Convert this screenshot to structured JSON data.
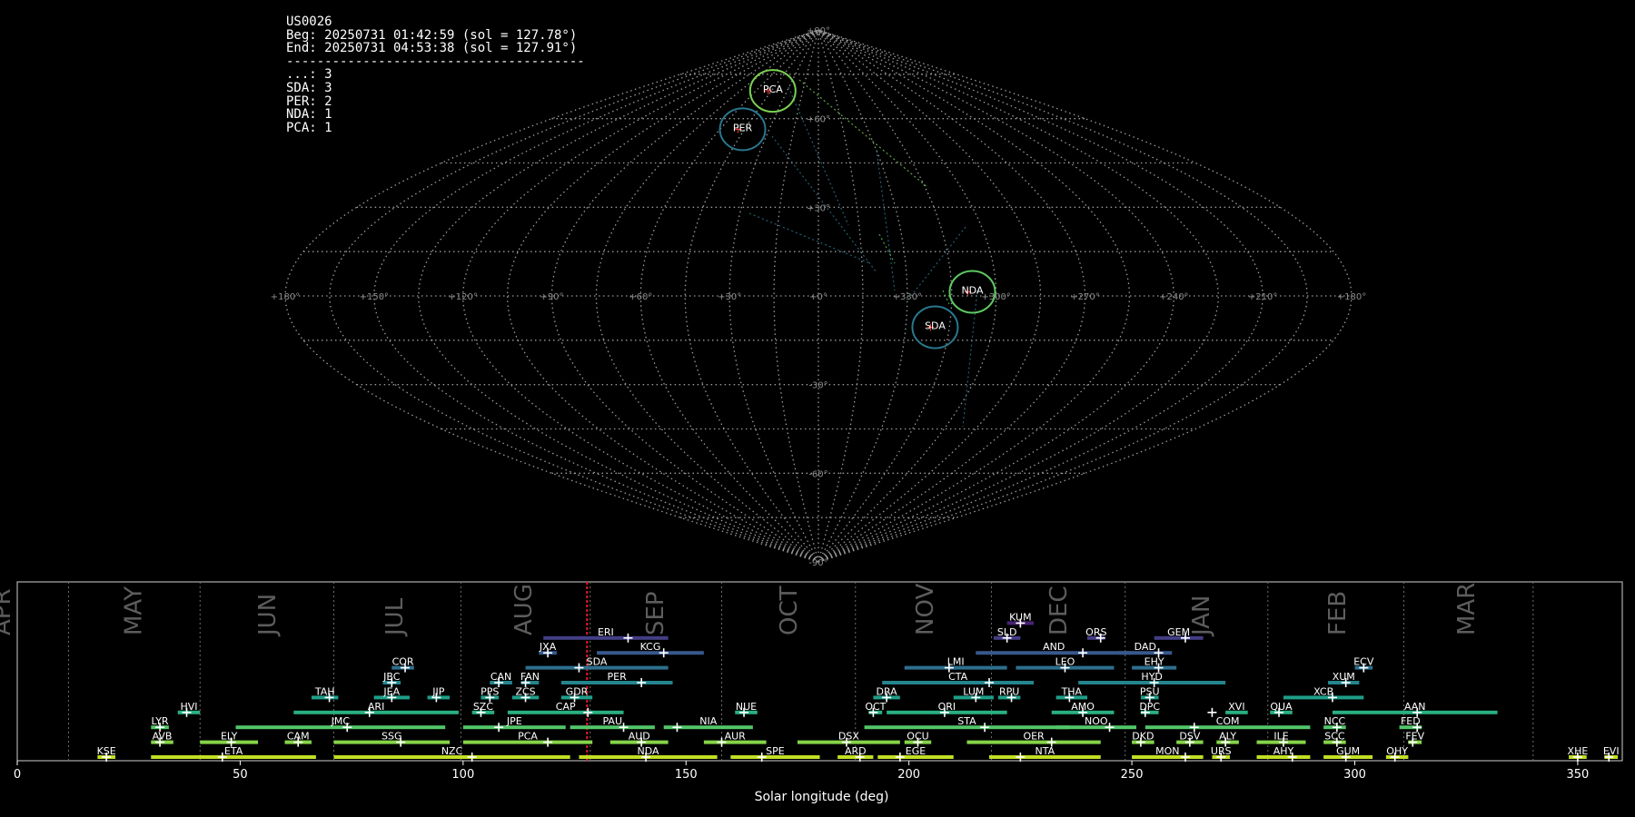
{
  "info": {
    "station": "US0026",
    "begin": "Beg: 20250731 01:42:59 (sol = 127.78°)",
    "end": "End: 20250731 04:53:38 (sol = 127.91°)",
    "separator": "---------------------------------------",
    "counts": [
      "...: 3",
      "SDA: 3",
      "PER: 2",
      "NDA: 1",
      "PCA: 1"
    ]
  },
  "chart_data": [
    {
      "type": "scatter",
      "projection": "sinusoidal",
      "grid": true,
      "lon_tick_labels": [
        "+180°",
        "+150°",
        "+120°",
        "+90°",
        "+60°",
        "+30°",
        "+0°",
        "+330°",
        "+300°",
        "+270°",
        "+240°",
        "+210°",
        "+180°"
      ],
      "lat_tick_labels": [
        "+90°",
        "+60°",
        "+30°",
        "-30°",
        "-60°",
        "-90°"
      ],
      "lon_ticks": [
        180,
        150,
        120,
        90,
        60,
        30,
        0,
        -30,
        -60,
        -90,
        -120,
        -150,
        -180
      ],
      "lat_ticks": [
        90,
        60,
        30,
        -30,
        -60,
        -90
      ],
      "radiants": [
        {
          "name": "PCA",
          "lon": 45,
          "lat": 70,
          "color": "#7ad151"
        },
        {
          "name": "PER",
          "lon": 47,
          "lat": 57,
          "color": "#2a788e"
        },
        {
          "name": "NDA",
          "lon": -52,
          "lat": 2,
          "color": "#5ec962"
        },
        {
          "name": "SDA",
          "lon": -40,
          "lat": -10,
          "color": "#2a788e"
        }
      ]
    },
    {
      "type": "timeline",
      "xlabel": "Solar longitude (deg)",
      "xlim": [
        0,
        360
      ],
      "xticks": [
        0,
        50,
        100,
        150,
        200,
        250,
        300,
        350
      ],
      "current_sol": 127.8,
      "months": [
        {
          "name": "APR",
          "sol": 11.5
        },
        {
          "name": "MAY",
          "sol": 41
        },
        {
          "name": "JUN",
          "sol": 71
        },
        {
          "name": "JUL",
          "sol": 99.5
        },
        {
          "name": "AUG",
          "sol": 128.5
        },
        {
          "name": "SEP",
          "sol": 158
        },
        {
          "name": "OCT",
          "sol": 188
        },
        {
          "name": "NOV",
          "sol": 218.5
        },
        {
          "name": "DEC",
          "sol": 248.5
        },
        {
          "name": "JAN",
          "sol": 280.5
        },
        {
          "name": "FEB",
          "sol": 311
        },
        {
          "name": "MAR",
          "sol": 340
        }
      ],
      "showers": [
        {
          "code": "KUM",
          "start": 222,
          "end": 228,
          "peak": 225,
          "row": 10
        },
        {
          "code": "ERI",
          "start": 118,
          "end": 146,
          "peak": 137,
          "row": 9
        },
        {
          "code": "SLD",
          "start": 219,
          "end": 225,
          "peak": 222,
          "row": 9
        },
        {
          "code": "ORS",
          "start": 240,
          "end": 244,
          "peak": 243,
          "row": 9
        },
        {
          "code": "GEM",
          "start": 255,
          "end": 266,
          "peak": 262,
          "row": 9
        },
        {
          "code": "JXA",
          "start": 117,
          "end": 121,
          "peak": 119,
          "row": 8
        },
        {
          "code": "KCG",
          "start": 130,
          "end": 154,
          "peak": 145,
          "row": 8
        },
        {
          "code": "AND",
          "start": 215,
          "end": 250,
          "peak": 239,
          "row": 8
        },
        {
          "code": "DAD",
          "start": 247,
          "end": 259,
          "peak": 256,
          "row": 8
        },
        {
          "code": "COR",
          "start": 84,
          "end": 89,
          "peak": 87,
          "row": 7
        },
        {
          "code": "SDA",
          "start": 114,
          "end": 146,
          "peak": 126,
          "row": 7
        },
        {
          "code": "LMI",
          "start": 199,
          "end": 222,
          "peak": 209,
          "row": 7
        },
        {
          "code": "LEO",
          "start": 224,
          "end": 246,
          "peak": 235,
          "row": 7
        },
        {
          "code": "EHY",
          "start": 250,
          "end": 260,
          "peak": 256,
          "row": 7
        },
        {
          "code": "ECV",
          "start": 300,
          "end": 304,
          "peak": 302,
          "row": 7
        },
        {
          "code": "JBC",
          "start": 82,
          "end": 86,
          "peak": 84,
          "row": 6
        },
        {
          "code": "CAN",
          "start": 106,
          "end": 111,
          "peak": 108,
          "row": 6
        },
        {
          "code": "FAN",
          "start": 113,
          "end": 117,
          "peak": 114,
          "row": 6
        },
        {
          "code": "PER",
          "start": 122,
          "end": 147,
          "peak": 140,
          "row": 6
        },
        {
          "code": "CTA",
          "start": 194,
          "end": 228,
          "peak": 218,
          "row": 6
        },
        {
          "code": "HYD",
          "start": 238,
          "end": 271,
          "peak": 255,
          "row": 6
        },
        {
          "code": "XUM",
          "start": 294,
          "end": 301,
          "peak": 298,
          "row": 6
        },
        {
          "code": "TAH",
          "start": 66,
          "end": 72,
          "peak": 70,
          "row": 5
        },
        {
          "code": "JEA",
          "start": 80,
          "end": 88,
          "peak": 84,
          "row": 5
        },
        {
          "code": "JIP",
          "start": 92,
          "end": 97,
          "peak": 94,
          "row": 5
        },
        {
          "code": "PPS",
          "start": 104,
          "end": 108,
          "peak": 106,
          "row": 5
        },
        {
          "code": "ZCS",
          "start": 111,
          "end": 117,
          "peak": 114,
          "row": 5
        },
        {
          "code": "GDR",
          "start": 122,
          "end": 129,
          "peak": 125,
          "row": 5
        },
        {
          "code": "DRA",
          "start": 192,
          "end": 198,
          "peak": 195,
          "row": 5
        },
        {
          "code": "LUM",
          "start": 210,
          "end": 219,
          "peak": 215,
          "row": 5
        },
        {
          "code": "RPU",
          "start": 220,
          "end": 225,
          "peak": 223,
          "row": 5
        },
        {
          "code": "THA",
          "start": 233,
          "end": 240,
          "peak": 236,
          "row": 5
        },
        {
          "code": "PSU",
          "start": 252,
          "end": 256,
          "peak": 254,
          "row": 5
        },
        {
          "code": "XCB",
          "start": 284,
          "end": 302,
          "peak": 295,
          "row": 5
        },
        {
          "code": "HVI",
          "start": 36,
          "end": 41,
          "peak": 38,
          "row": 4
        },
        {
          "code": "ARI",
          "start": 62,
          "end": 99,
          "peak": 79,
          "row": 4
        },
        {
          "code": "SZC",
          "start": 102,
          "end": 107,
          "peak": 104,
          "row": 4
        },
        {
          "code": "CAP",
          "start": 110,
          "end": 136,
          "peak": 128,
          "row": 4
        },
        {
          "code": "NUE",
          "start": 161,
          "end": 166,
          "peak": 163,
          "row": 4
        },
        {
          "code": "OCT",
          "start": 191,
          "end": 194,
          "peak": 192,
          "row": 4
        },
        {
          "code": "ORI",
          "start": 195,
          "end": 222,
          "peak": 208,
          "row": 4
        },
        {
          "code": "AMO",
          "start": 232,
          "end": 246,
          "peak": 239,
          "row": 4
        },
        {
          "code": "DPC",
          "start": 252,
          "end": 256,
          "peak": 253,
          "row": 4
        },
        {
          "code": "XVI",
          "start": 271,
          "end": 276,
          "peak": 268,
          "row": 4
        },
        {
          "code": "QUA",
          "start": 281,
          "end": 286,
          "peak": 283,
          "row": 4
        },
        {
          "code": "AAN",
          "start": 295,
          "end": 332,
          "peak": 314,
          "row": 4
        },
        {
          "code": "LYR",
          "start": 30,
          "end": 34,
          "peak": 32,
          "row": 3
        },
        {
          "code": "JMC",
          "start": 49,
          "end": 96,
          "peak": 74,
          "row": 3
        },
        {
          "code": "JPE",
          "start": 100,
          "end": 123,
          "peak": 108,
          "row": 3
        },
        {
          "code": "PAU",
          "start": 124,
          "end": 143,
          "peak": 136,
          "row": 3
        },
        {
          "code": "NIA",
          "start": 145,
          "end": 165,
          "peak": 148,
          "row": 3
        },
        {
          "code": "STA",
          "start": 190,
          "end": 236,
          "peak": 217,
          "row": 3
        },
        {
          "code": "NOO",
          "start": 233,
          "end": 251,
          "peak": 245,
          "row": 3
        },
        {
          "code": "COM",
          "start": 253,
          "end": 290,
          "peak": 264,
          "row": 3
        },
        {
          "code": "NCC",
          "start": 293,
          "end": 298,
          "peak": 296,
          "row": 3
        },
        {
          "code": "FED",
          "start": 310,
          "end": 315,
          "peak": 314,
          "row": 3
        },
        {
          "code": "AVB",
          "start": 30,
          "end": 35,
          "peak": 32,
          "row": 2
        },
        {
          "code": "ELY",
          "start": 41,
          "end": 54,
          "peak": 48,
          "row": 2
        },
        {
          "code": "CAM",
          "start": 60,
          "end": 66,
          "peak": 63,
          "row": 2
        },
        {
          "code": "SSG",
          "start": 71,
          "end": 97,
          "peak": 86,
          "row": 2
        },
        {
          "code": "PCA",
          "start": 100,
          "end": 129,
          "peak": 119,
          "row": 2
        },
        {
          "code": "AUD",
          "start": 133,
          "end": 146,
          "peak": 140,
          "row": 2
        },
        {
          "code": "AUR",
          "start": 154,
          "end": 168,
          "peak": 158,
          "row": 2
        },
        {
          "code": "DSX",
          "start": 175,
          "end": 198,
          "peak": 186,
          "row": 2
        },
        {
          "code": "OCU",
          "start": 199,
          "end": 205,
          "peak": 202,
          "row": 2
        },
        {
          "code": "OER",
          "start": 213,
          "end": 243,
          "peak": 232,
          "row": 2
        },
        {
          "code": "DKD",
          "start": 250,
          "end": 255,
          "peak": 252,
          "row": 2
        },
        {
          "code": "DSV",
          "start": 260,
          "end": 266,
          "peak": 263,
          "row": 2
        },
        {
          "code": "ALY",
          "start": 269,
          "end": 274,
          "peak": 271,
          "row": 2
        },
        {
          "code": "ILE",
          "start": 278,
          "end": 289,
          "peak": 284,
          "row": 2
        },
        {
          "code": "SCC",
          "start": 293,
          "end": 298,
          "peak": 296,
          "row": 2
        },
        {
          "code": "FEV",
          "start": 312,
          "end": 315,
          "peak": 313,
          "row": 2
        },
        {
          "code": "KSE",
          "start": 18,
          "end": 22,
          "peak": 20,
          "row": 1
        },
        {
          "code": "ETA",
          "start": 30,
          "end": 67,
          "peak": 46,
          "row": 1
        },
        {
          "code": "NZC",
          "start": 71,
          "end": 124,
          "peak": 102,
          "row": 1
        },
        {
          "code": "NDA",
          "start": 126,
          "end": 157,
          "peak": 141,
          "row": 1
        },
        {
          "code": "SPE",
          "start": 160,
          "end": 180,
          "peak": 167,
          "row": 1
        },
        {
          "code": "ARD",
          "start": 184,
          "end": 192,
          "peak": 189,
          "row": 1
        },
        {
          "code": "EGE",
          "start": 193,
          "end": 210,
          "peak": 198,
          "row": 1
        },
        {
          "code": "NTA",
          "start": 218,
          "end": 243,
          "peak": 225,
          "row": 1
        },
        {
          "code": "MON",
          "start": 250,
          "end": 266,
          "peak": 262,
          "row": 1
        },
        {
          "code": "URS",
          "start": 268,
          "end": 272,
          "peak": 270,
          "row": 1
        },
        {
          "code": "AHY",
          "start": 278,
          "end": 290,
          "peak": 286,
          "row": 1
        },
        {
          "code": "GUM",
          "start": 293,
          "end": 304,
          "peak": 298,
          "row": 1
        },
        {
          "code": "OHY",
          "start": 307,
          "end": 312,
          "peak": 309,
          "row": 1
        },
        {
          "code": "XHE",
          "start": 348,
          "end": 352,
          "peak": 350,
          "row": 1
        },
        {
          "code": "EVI",
          "start": 356,
          "end": 359,
          "peak": 357,
          "row": 1
        }
      ]
    }
  ]
}
